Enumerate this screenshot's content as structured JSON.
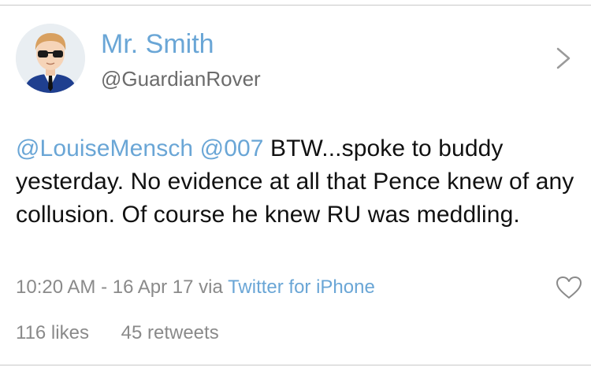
{
  "tweet": {
    "author_name": "Mr. Smith",
    "author_handle": "@GuardianRover",
    "mention_1": "@LouiseMensch",
    "mention_2": "@007",
    "body_line_1": " BTW...spoke to",
    "body_rest": "buddy yesterday. No evidence at all that Pence knew of any collusion. Of course he knew RU was meddling.",
    "timestamp": "10:20 AM - 16 Apr 17 via",
    "source": "Twitter for iPhone",
    "likes": "116 likes",
    "retweets": "45 retweets"
  },
  "icons": {
    "avatar": "avatar-man-sunglasses",
    "chevron": "chevron-right-icon",
    "like": "heart-icon"
  },
  "colors": {
    "link": "#6aa6d6",
    "text": "#111111",
    "meta": "#8a8a8a"
  }
}
